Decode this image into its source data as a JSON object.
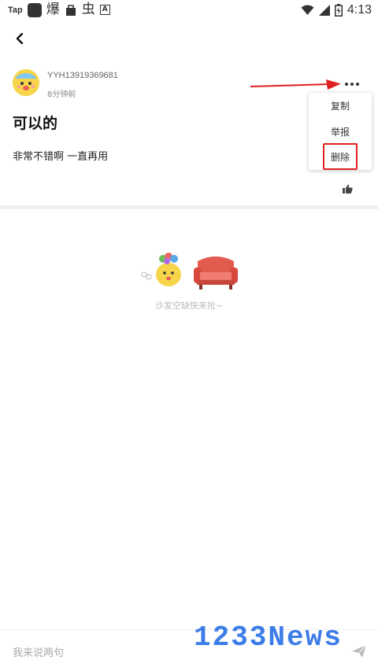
{
  "status_bar": {
    "app_label": "Tap",
    "glyph1": "爆",
    "glyph2": "虫",
    "letter_box": "A",
    "time": "4:13",
    "icons": [
      "wifi-icon",
      "signal-icon",
      "battery-icon"
    ]
  },
  "post": {
    "username": "YYH13919369681",
    "time_ago": "8分钟前",
    "title": "可以的",
    "body": "非常不错啊  一直再用"
  },
  "menu": {
    "items": [
      "复制",
      "举报",
      "删除"
    ]
  },
  "empty_state": {
    "text": "沙发空缺快来抢~"
  },
  "comment_bar": {
    "placeholder": "我来说两句"
  },
  "watermark": {
    "text": "1233News"
  },
  "colors": {
    "highlight": "#e02020",
    "arrow": "#e02020",
    "watermark": "#3d7de8",
    "avatar": "#f7d54a"
  }
}
